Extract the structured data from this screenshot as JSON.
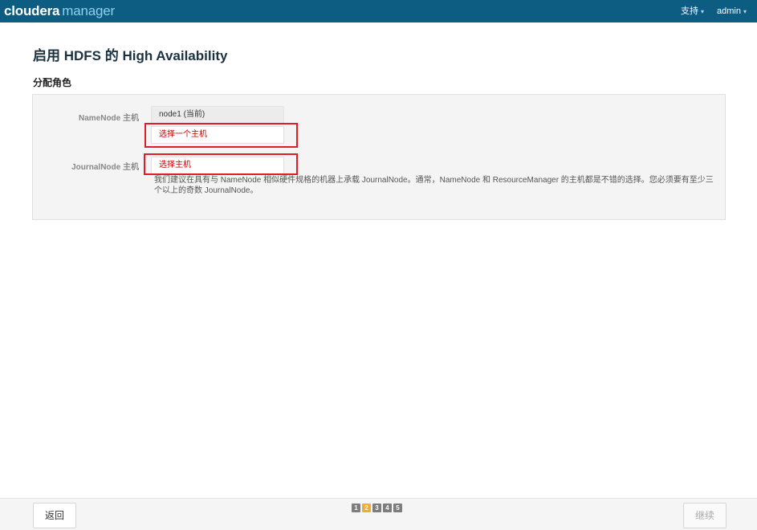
{
  "topbar": {
    "logo_main": "cloudera",
    "logo_sub": "manager",
    "support_label": "支持",
    "admin_label": "admin",
    "caret": "▾"
  },
  "page": {
    "title": "启用 HDFS 的 High Availability",
    "section_title": "分配角色"
  },
  "roles": {
    "namenode_label": "NameNode 主机",
    "namenode_current": "node1 (当前)",
    "namenode_select_placeholder": "选择一个主机",
    "journalnode_label": "JournalNode 主机",
    "journalnode_select_placeholder": "选择主机",
    "journalnode_help": "我们建议在具有与 NameNode 相似硬件规格的机器上承载 JournalNode。通常，NameNode 和 ResourceManager 的主机都是不错的选择。您必须要有至少三个以上的奇数 JournalNode。"
  },
  "footer": {
    "back_label": "返回",
    "continue_label": "继续",
    "steps": [
      "1",
      "2",
      "3",
      "4",
      "5"
    ],
    "active_step": 2
  },
  "colors": {
    "topbar": "#0d5c82",
    "highlight": "#e01d25",
    "active_step": "#f0ad31"
  }
}
